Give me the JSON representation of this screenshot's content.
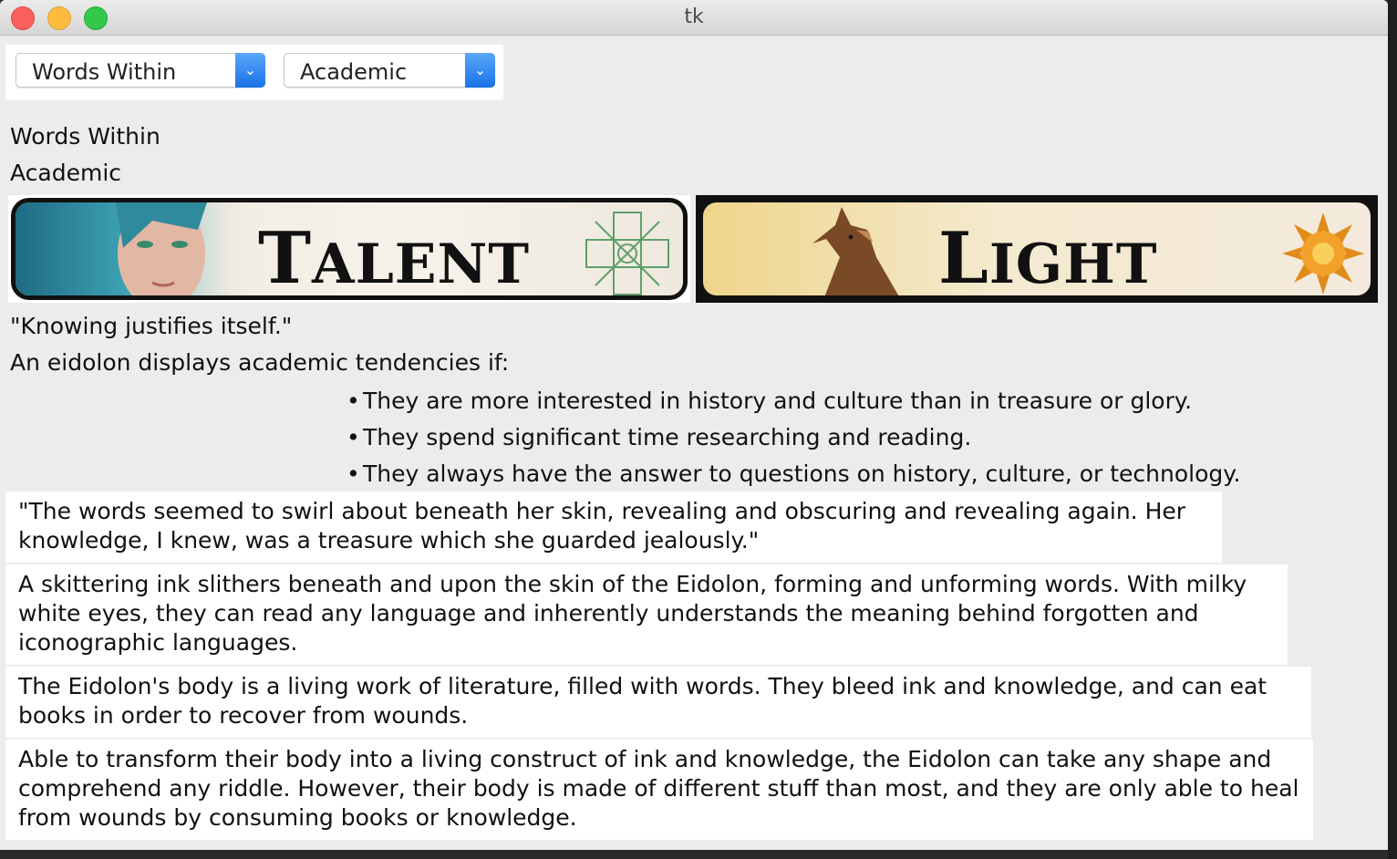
{
  "window": {
    "title": "tk"
  },
  "dropdowns": [
    {
      "value": "Words Within"
    },
    {
      "value": "Academic"
    }
  ],
  "labels": {
    "line1": "Words Within",
    "line2": "Academic"
  },
  "banners": [
    {
      "first_letter": "T",
      "rest": "ALENT"
    },
    {
      "first_letter": "L",
      "rest": "IGHT"
    }
  ],
  "motto": "\"Knowing justifies itself.\"",
  "intro": "An eidolon displays academic tendencies if:",
  "bullets": [
    "They are more interested in history and culture than in treasure or glory.",
    "They spend significant time researching and reading.",
    "They always have the answer to questions on history, culture, or technology."
  ],
  "paragraphs": [
    "\"The words seemed to swirl about beneath her skin, revealing and obscuring and revealing again. Her knowledge, I knew, was a treasure which she guarded jealously.\"",
    "A skittering ink slithers beneath and upon the skin of the Eidolon, forming and unforming words. With milky white eyes, they can read any language and inherently understands the meaning behind forgotten and iconographic languages.",
    "The Eidolon's body is a living work of literature, filled with words. They bleed ink and knowledge, and can eat books in order to recover from wounds.",
    "Able to transform their body into a living construct of ink and knowledge, the Eidolon can take any shape and comprehend any riddle. However, their body is made of different stuff than most, and they are only able to heal from wounds by consuming books or knowledge."
  ],
  "colors": {
    "accent": "#1a72e6",
    "window_bg": "#ececec"
  }
}
